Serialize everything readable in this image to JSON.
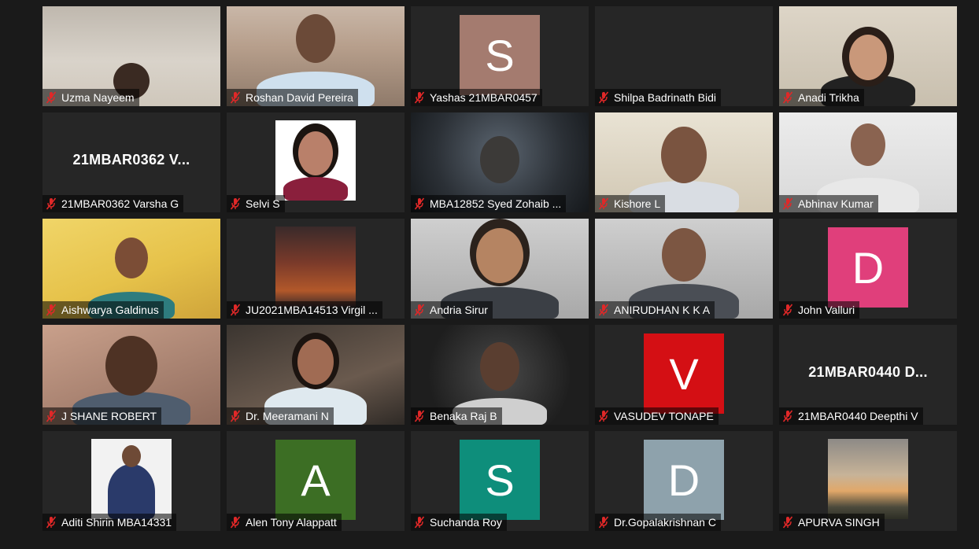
{
  "gallery": {
    "participants": [
      {
        "name": "Uzma Nayeem",
        "mic": "mic-muted-icon"
      },
      {
        "name": "Roshan David Pereira",
        "mic": "mic-muted-icon"
      },
      {
        "name": "Yashas 21MBAR0457",
        "mic": "mic-muted-icon",
        "avatar_letter": "S",
        "avatar_color": "#a47b6f"
      },
      {
        "name": "Shilpa Badrinath Bidi",
        "mic": "mic-muted-icon"
      },
      {
        "name": "Anadi Trikha",
        "mic": "mic-muted-icon"
      },
      {
        "name": "21MBAR0362 Varsha G",
        "mic": "mic-muted-icon",
        "display_title": "21MBAR0362 V..."
      },
      {
        "name": "Selvi S",
        "mic": "mic-muted-icon"
      },
      {
        "name": "MBA12852 Syed Zohaib ...",
        "mic": "mic-muted-icon"
      },
      {
        "name": "Kishore L",
        "mic": "mic-muted-icon"
      },
      {
        "name": "Abhinav Kumar",
        "mic": "mic-muted-icon"
      },
      {
        "name": "Aishwarya Galdinus",
        "mic": "mic-muted-icon"
      },
      {
        "name": "JU2021MBA14513 Virgil ...",
        "mic": "mic-muted-icon"
      },
      {
        "name": "Andria Sirur",
        "mic": "mic-muted-icon"
      },
      {
        "name": "ANIRUDHAN K K A",
        "mic": "mic-muted-icon"
      },
      {
        "name": "John Valluri",
        "mic": "mic-muted-icon",
        "avatar_letter": "D",
        "avatar_color": "#e03f7b"
      },
      {
        "name": "J SHANE ROBERT",
        "mic": "mic-muted-icon"
      },
      {
        "name": "Dr. Meeramani N",
        "mic": "mic-muted-icon"
      },
      {
        "name": "Benaka Raj B",
        "mic": "mic-muted-icon"
      },
      {
        "name": "VASUDEV TONAPE",
        "mic": "mic-muted-icon",
        "avatar_letter": "V",
        "avatar_color": "#d40f14"
      },
      {
        "name": "21MBAR0440 Deepthi V",
        "mic": "mic-muted-icon",
        "display_title": "21MBAR0440 D..."
      },
      {
        "name": "Aditi Shirin MBA14331",
        "mic": "mic-muted-icon"
      },
      {
        "name": "Alen Tony Alappatt",
        "mic": "mic-muted-icon",
        "avatar_letter": "A",
        "avatar_color": "#3c6e24"
      },
      {
        "name": "Suchanda Roy",
        "mic": "mic-muted-icon",
        "avatar_letter": "S",
        "avatar_color": "#0e8e7b"
      },
      {
        "name": "Dr.Gopalakrishnan C",
        "mic": "mic-muted-icon",
        "avatar_letter": "D",
        "avatar_color": "#8ea2ac"
      },
      {
        "name": "APURVA SINGH",
        "mic": "mic-muted-icon"
      }
    ]
  },
  "colors": {
    "background": "#1a1a1a",
    "tile": "#262626",
    "mic_muted": "#e02828"
  }
}
